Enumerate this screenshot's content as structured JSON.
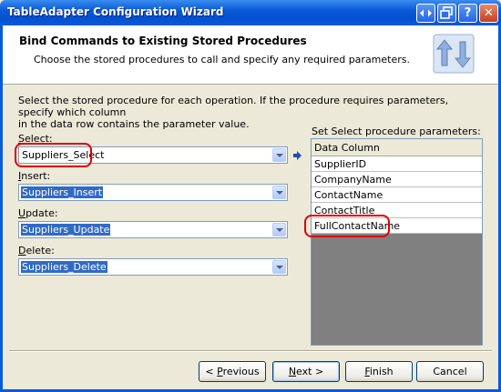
{
  "window": {
    "title": "TableAdapter Configuration Wizard"
  },
  "title_buttons": {
    "back_forward": "◆",
    "restore": "❐",
    "help": "?",
    "close": "✕"
  },
  "header": {
    "heading": "Bind Commands to Existing Stored Procedures",
    "subheading": "Choose the stored procedures to call and specify any required parameters."
  },
  "intro": {
    "line1": "Select the stored procedure for each operation. If the procedure requires parameters, specify which column",
    "line2": "in the data row contains the parameter value."
  },
  "fields": {
    "select": {
      "label_accel": "S",
      "label_rest": "elect:",
      "value": "Suppliers_Select"
    },
    "insert": {
      "label_accel": "I",
      "label_rest": "nsert:",
      "value": "Suppliers_Insert"
    },
    "update": {
      "label_accel": "U",
      "label_rest": "pdate:",
      "value": "Suppliers_Update"
    },
    "delete": {
      "label_accel": "D",
      "label_rest": "elete:",
      "value": "Suppliers_Delete"
    }
  },
  "params": {
    "title": "Set Select procedure parameters:",
    "column_header": "Data Column",
    "rows": [
      "SupplierID",
      "CompanyName",
      "ContactName",
      "ContactTitle",
      "FullContactName"
    ]
  },
  "buttons": {
    "previous_accel": "P",
    "previous_pre": "< ",
    "previous_rest": "revious",
    "next_accel": "N",
    "next_rest": "ext >",
    "finish_accel": "F",
    "finish_rest": "inish",
    "cancel": "Cancel"
  },
  "colors": {
    "titlebar": "#0a5bd8",
    "selection": "#316ac5",
    "highlight_oval": "#e00000"
  }
}
